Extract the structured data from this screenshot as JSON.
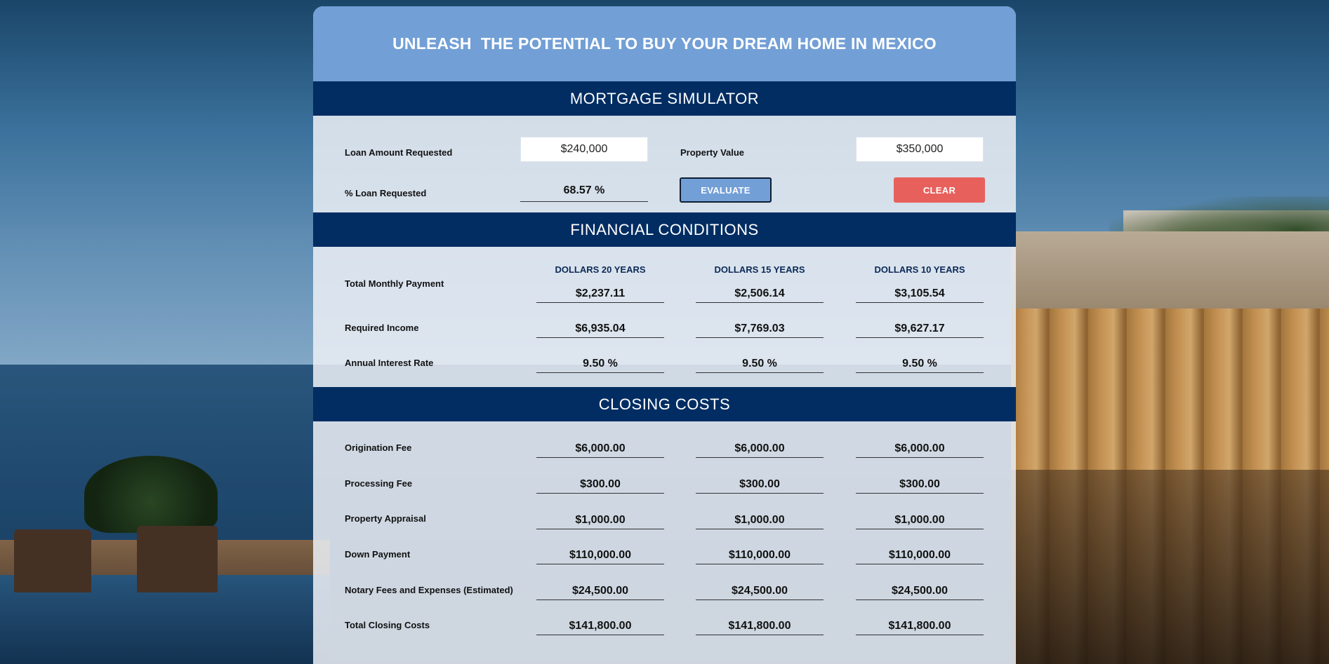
{
  "hero": {
    "title": "UNLEASH  THE POTENTIAL TO BUY YOUR DREAM HOME IN MEXICO"
  },
  "simulator": {
    "header": "MORTGAGE SIMULATOR",
    "loan_label": "Loan Amount Requested",
    "loan_value": "$240,000",
    "property_label": "Property Value",
    "property_value": "$350,000",
    "percent_label": "% Loan Requested",
    "percent_value": "68.57 %",
    "evaluate_label": "EVALUATE",
    "clear_label": "CLEAR"
  },
  "financial": {
    "header": "FINANCIAL CONDITIONS",
    "columns": [
      "DOLLARS  20 YEARS",
      "DOLLARS  15 YEARS",
      "DOLLARS  10 YEARS"
    ],
    "rows": [
      {
        "label": "Total Monthly Payment",
        "values": [
          "$2,237.11",
          "$2,506.14",
          "$3,105.54"
        ]
      },
      {
        "label": "Required Income",
        "values": [
          "$6,935.04",
          "$7,769.03",
          "$9,627.17"
        ]
      },
      {
        "label": "Annual Interest Rate",
        "values": [
          "9.50 %",
          "9.50 %",
          "9.50 %"
        ]
      }
    ]
  },
  "closing": {
    "header": "CLOSING COSTS",
    "rows": [
      {
        "label": "Origination Fee",
        "values": [
          "$6,000.00",
          "$6,000.00",
          "$6,000.00"
        ]
      },
      {
        "label": "Processing Fee",
        "values": [
          "$300.00",
          "$300.00",
          "$300.00"
        ]
      },
      {
        "label": "Property Appraisal",
        "values": [
          "$1,000.00",
          "$1,000.00",
          "$1,000.00"
        ]
      },
      {
        "label": "Down Payment",
        "values": [
          "$110,000.00",
          "$110,000.00",
          "$110,000.00"
        ]
      },
      {
        "label": "Notary Fees and Expenses (Estimated)",
        "values": [
          "$24,500.00",
          "$24,500.00",
          "$24,500.00"
        ]
      },
      {
        "label": "Total Closing Costs",
        "values": [
          "$141,800.00",
          "$141,800.00",
          "$141,800.00"
        ]
      }
    ]
  }
}
